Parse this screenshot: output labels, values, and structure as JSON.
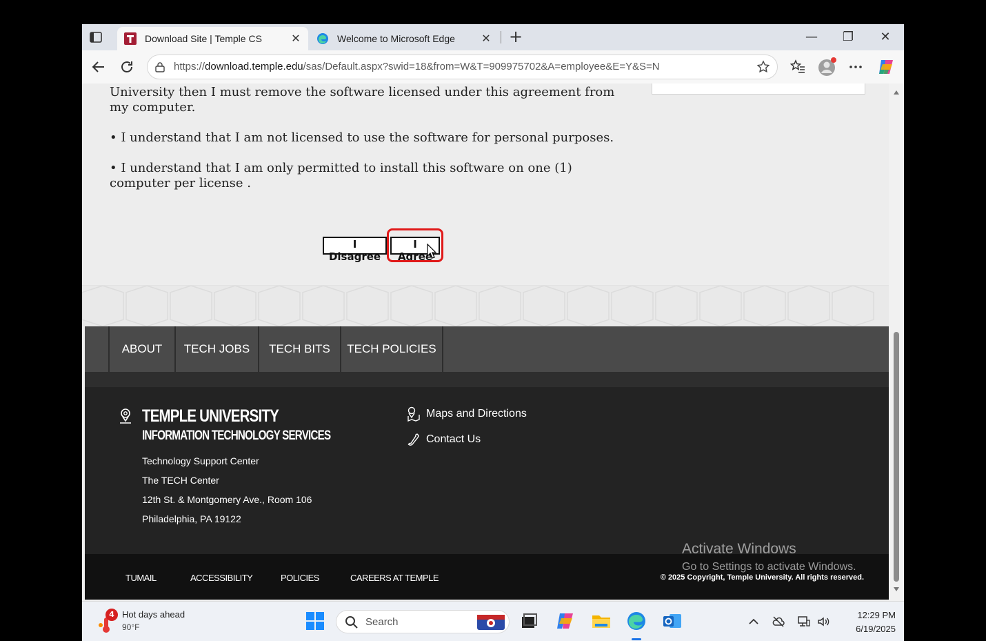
{
  "browser": {
    "tabs": [
      {
        "title": "Download Site | Temple CS",
        "active": true
      },
      {
        "title": "Welcome to Microsoft Edge",
        "active": false
      }
    ],
    "url_prefix": "https://",
    "url_host": "download.temple.edu",
    "url_path": "/sas/Default.aspx?swid=18&from=W&T=909975702&A=employee&E=Y&S=N"
  },
  "terms": {
    "p1": "University then I must remove the software licensed under this agreement from my computer.",
    "p2": "• I understand that I am not licensed to use the software for personal purposes.",
    "p3": "• I understand that I am only permitted to install this software on one (1) computer per license ."
  },
  "buttons": {
    "disagree": "I Disagree",
    "agree": "I Agree"
  },
  "footer_nav": [
    "ABOUT",
    "TECH JOBS",
    "TECH BITS",
    "TECH POLICIES"
  ],
  "footer": {
    "brand_line1": "TEMPLE UNIVERSITY",
    "brand_line2": "INFORMATION TECHNOLOGY SERVICES",
    "address": [
      "Technology Support Center",
      "The TECH Center",
      "12th St. & Montgomery Ave., Room 106",
      "Philadelphia, PA 19122"
    ],
    "maps": "Maps and Directions",
    "contact": "Contact Us",
    "bottom_links": [
      "TUMAIL",
      "ACCESSIBILITY",
      "POLICIES",
      "CAREERS AT TEMPLE"
    ],
    "copyright": "© 2025 Copyright, Temple University. All rights reserved."
  },
  "watermark": {
    "line1": "Activate Windows",
    "line2": "Go to Settings to activate Windows."
  },
  "taskbar": {
    "weather_title": "Hot days ahead",
    "weather_temp": "90°F",
    "weather_badge": "4",
    "search_label": "Search",
    "time": "12:29 PM",
    "date": "6/19/2025"
  },
  "colors": {
    "highlight": "#e01919",
    "temple_red": "#a41e35",
    "footer_dark": "#232323"
  }
}
